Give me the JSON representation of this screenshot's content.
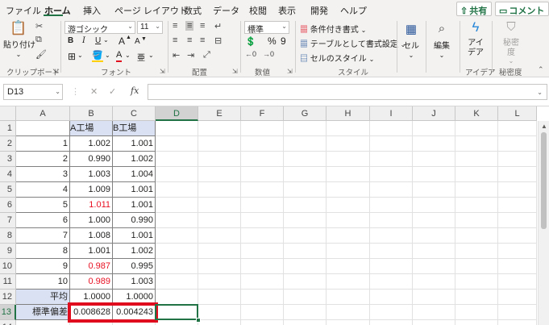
{
  "menu": {
    "tabs": [
      "ファイル",
      "ホーム",
      "挿入",
      "ページ レイアウト",
      "数式",
      "データ",
      "校閲",
      "表示",
      "開発",
      "ヘルプ"
    ],
    "active_tab": "ホーム",
    "share_label": "共有",
    "comment_label": "コメント"
  },
  "ribbon": {
    "clipboard": {
      "paste_label": "貼り付け",
      "group_label": "クリップボード"
    },
    "font": {
      "font_name": "游ゴシック",
      "font_size": "11",
      "grow_label": "A",
      "shrink_label": "A",
      "bold": "B",
      "italic": "I",
      "underline": "U",
      "color_letter": "A",
      "furigana": "亜",
      "group_label": "フォント"
    },
    "alignment": {
      "group_label": "配置"
    },
    "number": {
      "format": "標準",
      "percent": "%",
      "comma": "9",
      "group_label": "数値"
    },
    "styles": {
      "conditional": "条件付き書式",
      "table": "テーブルとして書式設定",
      "cell_styles": "セルのスタイル",
      "group_label": "スタイル"
    },
    "cells": {
      "label": "セル"
    },
    "editing": {
      "label": "編集"
    },
    "ideas": {
      "label1": "アイ",
      "label2": "デア",
      "group_label": "アイデア"
    },
    "sensitivity": {
      "label1": "秘密",
      "label2": "度",
      "group_label": "秘密度"
    }
  },
  "formula_bar": {
    "name_box": "D13",
    "fx": "fx",
    "formula": ""
  },
  "sheet": {
    "columns": [
      "A",
      "B",
      "C",
      "D",
      "E",
      "F",
      "G",
      "H",
      "I",
      "J",
      "K",
      "L"
    ],
    "rows": [
      "1",
      "2",
      "3",
      "4",
      "5",
      "6",
      "7",
      "8",
      "9",
      "10",
      "11",
      "12",
      "13",
      "14"
    ],
    "selected_cell": "D13",
    "header_row": {
      "b": "A工場",
      "c": "B工場"
    },
    "data_rows": [
      {
        "a": "1",
        "b": "1.002",
        "c": "1.001",
        "b_red": false
      },
      {
        "a": "2",
        "b": "0.990",
        "c": "1.002",
        "b_red": false
      },
      {
        "a": "3",
        "b": "1.003",
        "c": "1.004",
        "b_red": false
      },
      {
        "a": "4",
        "b": "1.009",
        "c": "1.001",
        "b_red": false
      },
      {
        "a": "5",
        "b": "1.011",
        "c": "1.001",
        "b_red": true
      },
      {
        "a": "6",
        "b": "1.000",
        "c": "0.990",
        "b_red": false
      },
      {
        "a": "7",
        "b": "1.008",
        "c": "1.001",
        "b_red": false
      },
      {
        "a": "8",
        "b": "1.001",
        "c": "1.002",
        "b_red": false
      },
      {
        "a": "9",
        "b": "0.987",
        "c": "0.995",
        "b_red": true
      },
      {
        "a": "10",
        "b": "0.989",
        "c": "1.003",
        "b_red": true
      }
    ],
    "average_row": {
      "label": "平均",
      "b": "1.0000",
      "c": "1.0000"
    },
    "stdev_row": {
      "label": "標準偏差",
      "b": "0.008628",
      "c": "0.004243"
    }
  },
  "colors": {
    "accent": "#217346",
    "highlight": "#e00d1e",
    "red_text": "#e81123",
    "header_fill": "#d9e1f2"
  }
}
